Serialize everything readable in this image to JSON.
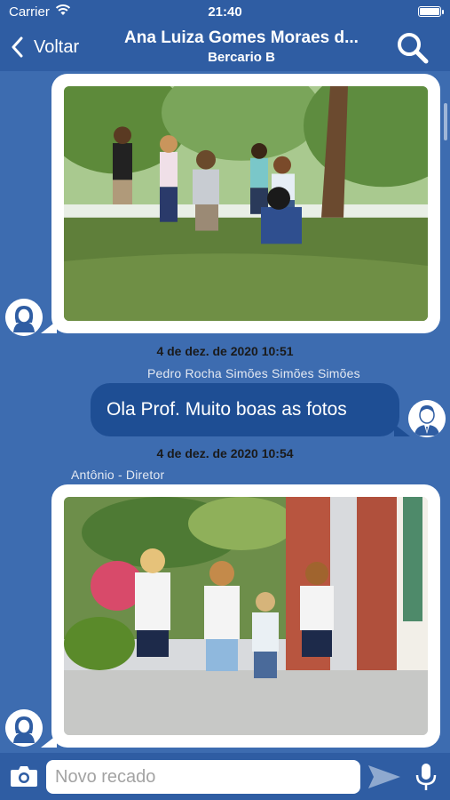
{
  "status_bar": {
    "carrier": "Carrier",
    "time": "21:40"
  },
  "header": {
    "back_label": "Voltar",
    "title": "Ana Luiza Gomes Moraes d...",
    "subtitle": "Bercario B",
    "icons": {
      "back": "chevron-left-icon",
      "search": "search-icon"
    }
  },
  "messages": [
    {
      "type": "image",
      "direction": "incoming",
      "photo": "children-playing-in-park",
      "avatar": "teacher-avatar-female"
    },
    {
      "type": "text",
      "direction": "outgoing",
      "timestamp": "4 de dez. de 2020 10:51",
      "sender": "Pedro Rocha Simões Simões Simões",
      "text": "Ola Prof. Muito boas as fotos",
      "avatar": "parent-avatar-male"
    },
    {
      "type": "image",
      "direction": "incoming",
      "timestamp": "4 de dez. de 2020 10:54",
      "sender": "Antônio - Diretor",
      "photo": "children-running-with-masks",
      "avatar": "teacher-avatar-female"
    }
  ],
  "composer": {
    "placeholder": "Novo recado",
    "value": "",
    "icons": {
      "camera": "camera-icon",
      "send": "send-icon",
      "mic": "microphone-icon"
    }
  },
  "colors": {
    "bar": "#2f5da3",
    "background": "#3d6cb0",
    "outgoing_bubble": "#1e4e94",
    "incoming_bubble": "#ffffff"
  }
}
